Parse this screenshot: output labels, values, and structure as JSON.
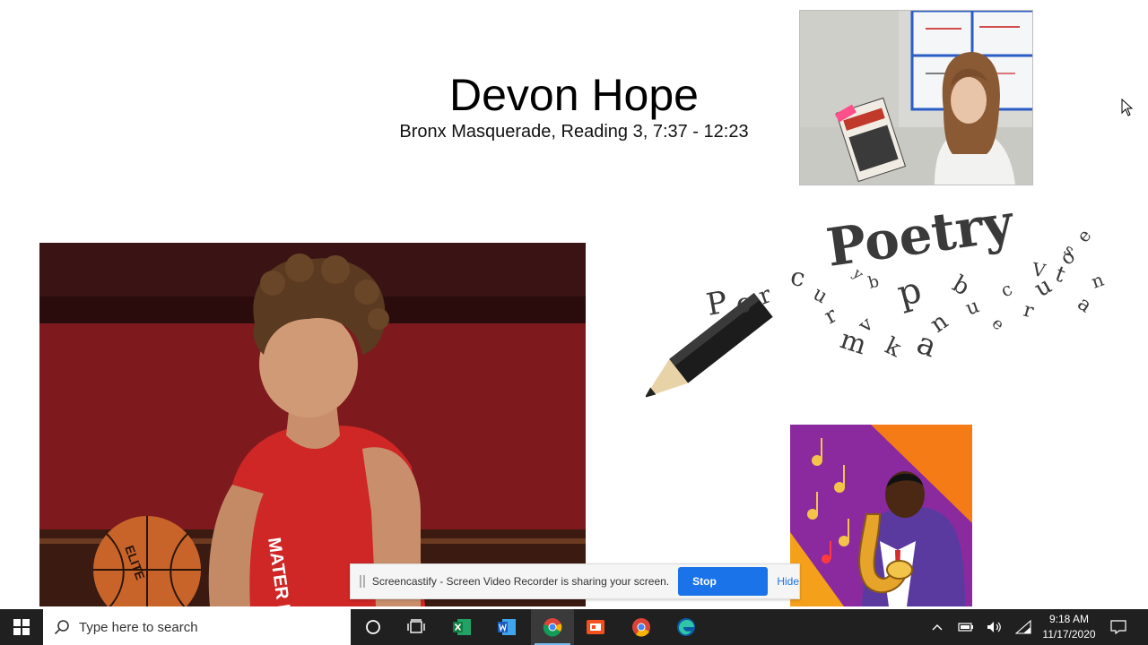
{
  "slide": {
    "title": "Devon Hope",
    "subtitle": "Bronx Masquerade, Reading 3, 7:37 - 12:23",
    "poetry_word": "Poetry",
    "jersey_text": "MATER DEI",
    "ball_text": "ELITE"
  },
  "notification": {
    "message": "Screencastify - Screen Video Recorder is sharing your screen.",
    "stop_label": "Stop sharing",
    "hide_label": "Hide"
  },
  "taskbar": {
    "search_placeholder": "Type here to search",
    "time": "9:18 AM",
    "date": "11/17/2020",
    "apps": [
      "cortana-icon",
      "task-view-icon",
      "excel-icon",
      "word-icon",
      "chrome-icon",
      "screencastify-icon",
      "chrome-alt-icon",
      "edge-icon"
    ]
  },
  "colors": {
    "taskbar_bg": "#202020",
    "accent": "#1a73e8",
    "jersey_red": "#d42b2b"
  }
}
